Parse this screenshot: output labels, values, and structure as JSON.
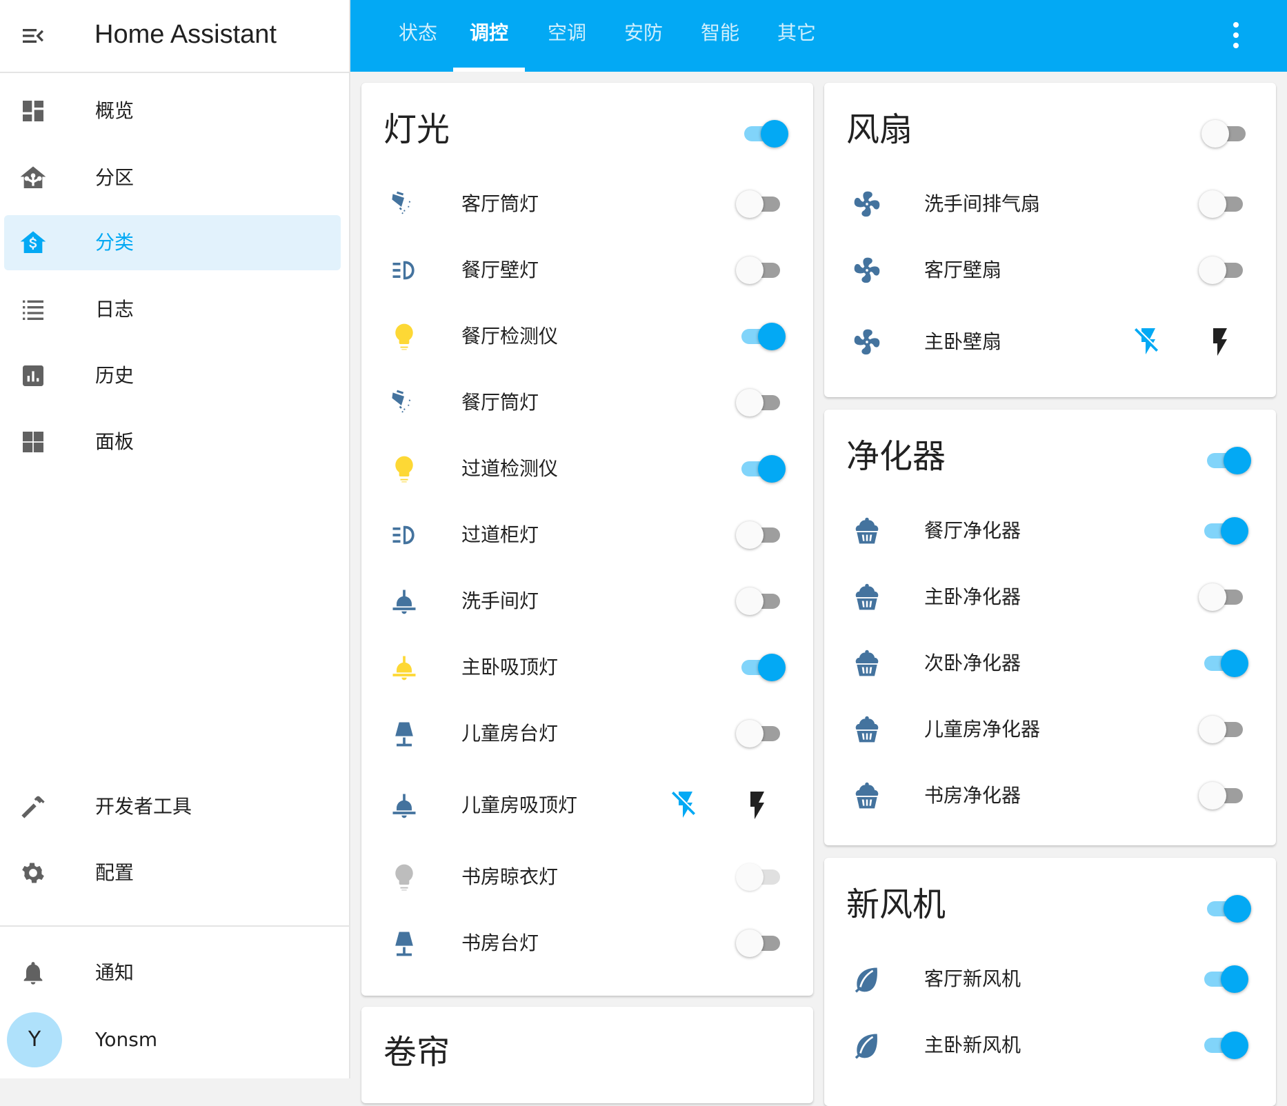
{
  "app": {
    "title": "Home Assistant"
  },
  "sidebar": {
    "items": [
      {
        "label": "概览",
        "icon": "dashboard-icon"
      },
      {
        "label": "分区",
        "icon": "home-tree-icon"
      },
      {
        "label": "分类",
        "icon": "home-currency-icon",
        "active": true
      },
      {
        "label": "日志",
        "icon": "format-list-icon"
      },
      {
        "label": "历史",
        "icon": "chart-box-icon"
      },
      {
        "label": "面板",
        "icon": "view-dashboard-icon"
      }
    ],
    "bottom_items": [
      {
        "label": "开发者工具",
        "icon": "hammer-icon"
      },
      {
        "label": "配置",
        "icon": "cog-icon"
      }
    ],
    "notifications_label": "通知",
    "user": {
      "initial": "Y",
      "name": "Yonsm"
    }
  },
  "header": {
    "tabs": [
      {
        "label": "状态"
      },
      {
        "label": "调控",
        "active": true
      },
      {
        "label": "空调"
      },
      {
        "label": "安防"
      },
      {
        "label": "智能"
      },
      {
        "label": "其它"
      }
    ]
  },
  "cards": {
    "lights": {
      "title": "灯光",
      "header_toggle": "on",
      "rows": [
        {
          "name": "客厅筒灯",
          "icon": "spotlight-beam-icon",
          "state": "off"
        },
        {
          "name": "餐厅壁灯",
          "icon": "car-light-dimmed-icon",
          "state": "off"
        },
        {
          "name": "餐厅检测仪",
          "icon": "lightbulb-icon",
          "icon_color": "#fdd835",
          "state": "on"
        },
        {
          "name": "餐厅筒灯",
          "icon": "spotlight-beam-icon",
          "state": "off"
        },
        {
          "name": "过道检测仪",
          "icon": "lightbulb-icon",
          "icon_color": "#fdd835",
          "state": "on"
        },
        {
          "name": "过道柜灯",
          "icon": "car-light-dimmed-icon",
          "state": "off"
        },
        {
          "name": "洗手间灯",
          "icon": "ceiling-light-icon",
          "state": "off"
        },
        {
          "name": "主卧吸顶灯",
          "icon": "ceiling-light-icon",
          "icon_color": "#fdd835",
          "state": "on"
        },
        {
          "name": "儿童房台灯",
          "icon": "desk-lamp-icon",
          "state": "off"
        },
        {
          "name": "儿童房吸顶灯",
          "icon": "ceiling-light-icon",
          "state": "assumed"
        },
        {
          "name": "书房晾衣灯",
          "icon": "lightbulb-icon",
          "icon_color": "#bdbdbd",
          "state": "unavailable"
        },
        {
          "name": "书房台灯",
          "icon": "desk-lamp-icon",
          "state": "off"
        }
      ]
    },
    "covers": {
      "title": "卷帘"
    },
    "fans": {
      "title": "风扇",
      "header_toggle": "off",
      "rows": [
        {
          "name": "洗手间排气扇",
          "icon": "fan-icon",
          "state": "off"
        },
        {
          "name": "客厅壁扇",
          "icon": "fan-icon",
          "state": "off"
        },
        {
          "name": "主卧壁扇",
          "icon": "fan-icon",
          "state": "assumed"
        }
      ]
    },
    "purifiers": {
      "title": "净化器",
      "header_toggle": "on",
      "rows": [
        {
          "name": "餐厅净化器",
          "icon": "cupcake-icon",
          "state": "on"
        },
        {
          "name": "主卧净化器",
          "icon": "cupcake-icon",
          "state": "off"
        },
        {
          "name": "次卧净化器",
          "icon": "cupcake-icon",
          "state": "on"
        },
        {
          "name": "儿童房净化器",
          "icon": "cupcake-icon",
          "state": "off"
        },
        {
          "name": "书房净化器",
          "icon": "cupcake-icon",
          "state": "off"
        }
      ]
    },
    "fresh_air": {
      "title": "新风机",
      "header_toggle": "on",
      "rows": [
        {
          "name": "客厅新风机",
          "icon": "leaf-icon",
          "state": "on"
        },
        {
          "name": "主卧新风机",
          "icon": "leaf-icon",
          "state": "on"
        }
      ]
    }
  },
  "colors": {
    "primary": "#03a9f4",
    "icon_default": "#44739e",
    "toggle_on_track": "#81d4fa",
    "toggle_off_track": "#9e9e9e",
    "sidebar_active_bg": "#e2f2fc"
  }
}
